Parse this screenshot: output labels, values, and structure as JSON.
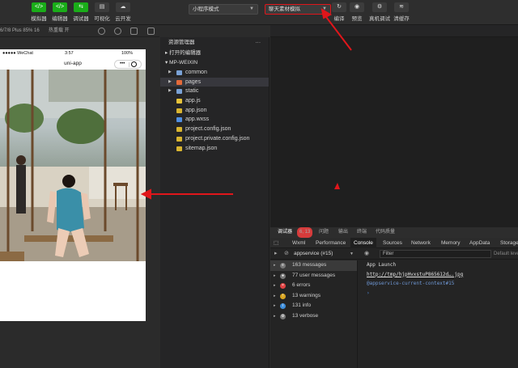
{
  "toolbar": {
    "buttons": [
      {
        "icon": "</>",
        "label": "模拟器"
      },
      {
        "icon": "</>",
        "label": "编辑器"
      },
      {
        "icon": "⇆",
        "label": "调试器"
      },
      {
        "icon": "▤",
        "label": "可视化"
      },
      {
        "icon": "☁",
        "label": "云开发"
      }
    ],
    "mode_select": "小程序模式",
    "compile_select": "聊天素材模拟",
    "right_buttons": [
      {
        "icon": "↻",
        "label": "编译"
      },
      {
        "icon": "◉",
        "label": "预览"
      },
      {
        "icon": "⚙",
        "label": "真机调试"
      },
      {
        "icon": "≋",
        "label": "清缓存"
      }
    ]
  },
  "simulator": {
    "device": "6/7/8 Plus 85% 16",
    "hotreload": "热重载 开",
    "status_left": "●●●●● WeChat",
    "time": "3:57",
    "battery": "100%",
    "nav_title": "uni-app"
  },
  "explorer": {
    "title": "资源管理器",
    "menu": "···",
    "sections": [
      "打开的编辑器",
      "MP-WEIXIN"
    ],
    "items": [
      {
        "name": "common",
        "type": "folder",
        "color": "#7aa2d6",
        "arrow": "▶"
      },
      {
        "name": "pages",
        "type": "folder",
        "color": "#e46a3a",
        "arrow": "▶"
      },
      {
        "name": "static",
        "type": "folder",
        "color": "#7aa2d6",
        "arrow": "▶"
      },
      {
        "name": "app.js",
        "type": "file",
        "color": "#e6c33a",
        "arrow": ""
      },
      {
        "name": "app.json",
        "type": "file",
        "color": "#d9b530",
        "arrow": ""
      },
      {
        "name": "app.wxss",
        "type": "file",
        "color": "#4f8fe3",
        "arrow": ""
      },
      {
        "name": "project.config.json",
        "type": "file",
        "color": "#d9b530",
        "arrow": ""
      },
      {
        "name": "project.private.config.json",
        "type": "file",
        "color": "#d9b530",
        "arrow": ""
      },
      {
        "name": "sitemap.json",
        "type": "file",
        "color": "#d9b530",
        "arrow": ""
      }
    ]
  },
  "devtools": {
    "panel_tabs": [
      "调试器",
      "问题",
      "输出",
      "终端",
      "代码质量"
    ],
    "error_badge": "6, 13",
    "tabs": [
      "Wxml",
      "Performance",
      "Console",
      "Sources",
      "Network",
      "Memory",
      "AppData",
      "Storage"
    ],
    "active_tab": "Console",
    "context": "appservice (#15)",
    "filter_placeholder": "Filter",
    "levels": "Default levels",
    "messages": [
      {
        "label": "163 messages",
        "icon": "≡",
        "color": "#777"
      },
      {
        "label": "77 user messages",
        "icon": "●",
        "color": "#777"
      },
      {
        "label": "6 errors",
        "icon": "×",
        "color": "#e04343"
      },
      {
        "label": "13 warnings",
        "icon": "!",
        "color": "#d9a520"
      },
      {
        "label": "131 info",
        "icon": "i",
        "color": "#3f8fdc"
      },
      {
        "label": "13 verbose",
        "icon": "⚙",
        "color": "#777"
      }
    ],
    "output": [
      {
        "text": "App Launch",
        "color": "#dcdcdc"
      },
      {
        "text": "http://tmp/hjpHvxstuP865612d….jpg",
        "color": "#e2e2e2"
      },
      {
        "text": "@appservice-current-context#15",
        "color": "#6f98d6"
      },
      {
        "text": "›",
        "color": "#4f8fe3"
      }
    ]
  }
}
